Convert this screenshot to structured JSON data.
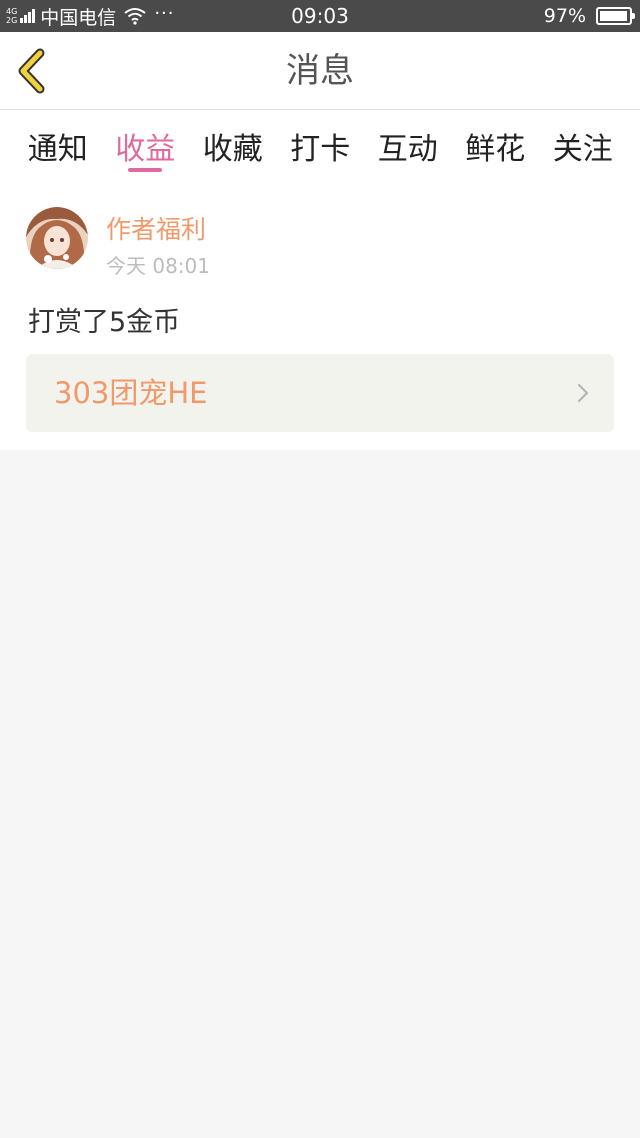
{
  "status_bar": {
    "net_top": "4G",
    "net_bottom": "2G",
    "carrier": "中国电信",
    "more": "···",
    "time": "09:03",
    "battery_percent": "97%",
    "battery_level": 0.97,
    "icons": [
      "signal-icon",
      "wifi-icon",
      "battery-icon"
    ]
  },
  "header": {
    "back_icon": "chevron-left-icon",
    "back_color": "#f2d23c",
    "title": "消息"
  },
  "tabs": [
    {
      "label": "通知",
      "active": false
    },
    {
      "label": "收益",
      "active": true
    },
    {
      "label": "收藏",
      "active": false
    },
    {
      "label": "打卡",
      "active": false
    },
    {
      "label": "互动",
      "active": false
    },
    {
      "label": "鲜花",
      "active": false
    },
    {
      "label": "关注",
      "active": false
    }
  ],
  "message_card": {
    "avatar_icon": "avatar",
    "author": "作者福利",
    "time": "今天 08:01",
    "content": "打赏了5金币",
    "link_label": "303团宠HE",
    "link_icon": "chevron-right-icon"
  },
  "colors": {
    "accent": "#e06aa0",
    "orange": "#f0996a",
    "status_bar": "#4a4a4a"
  }
}
